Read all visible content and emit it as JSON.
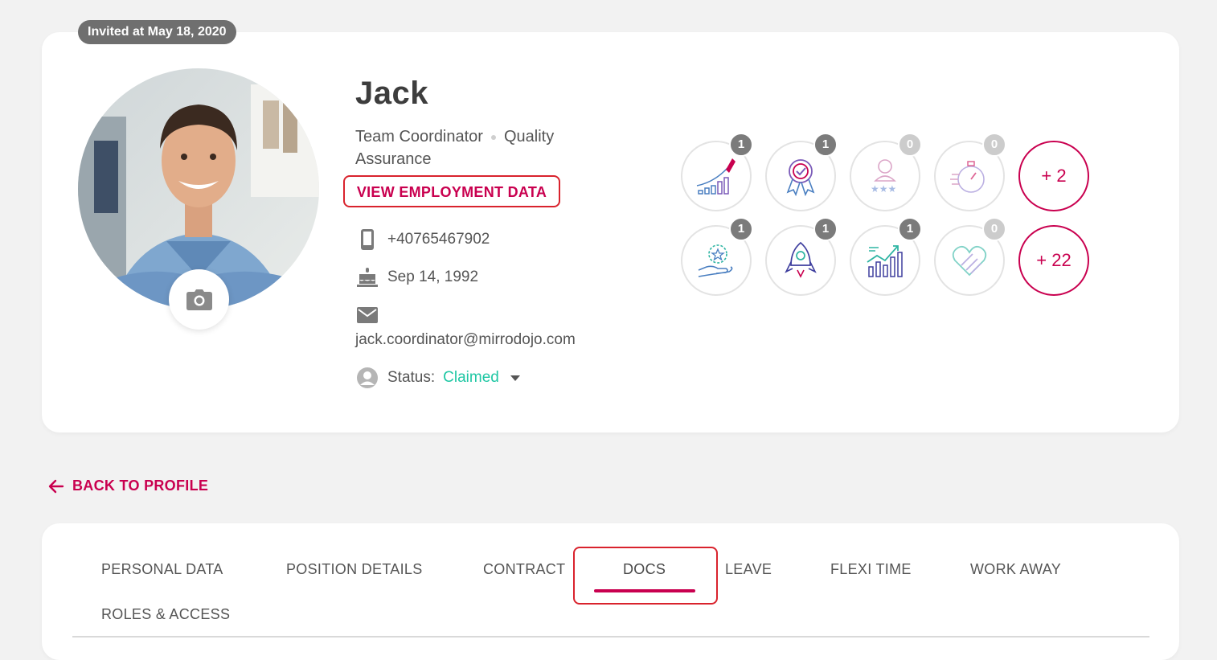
{
  "profile": {
    "invited_label": "Invited at May 18, 2020",
    "name": "Jack",
    "role": "Team Coordinator",
    "department": "Quality Assurance",
    "view_employment_label": "VIEW EMPLOYMENT DATA",
    "phone": "+40765467902",
    "birthday": "Sep 14, 1992",
    "email": "jack.coordinator@mirrodojo.com",
    "status_label": "Status:",
    "status_value": "Claimed"
  },
  "badges": {
    "row1": [
      {
        "icon": "rocket-growth-icon",
        "count": "1"
      },
      {
        "icon": "award-ribbon-icon",
        "count": "1"
      },
      {
        "icon": "person-rating-icon",
        "count": "0"
      },
      {
        "icon": "stopwatch-icon",
        "count": "0"
      }
    ],
    "row2": [
      {
        "icon": "hand-star-icon",
        "count": "1"
      },
      {
        "icon": "rocket-launch-icon",
        "count": "1"
      },
      {
        "icon": "growth-chart-icon",
        "count": "1"
      },
      {
        "icon": "heart-hand-icon",
        "count": "0"
      }
    ],
    "more_row1": "+ 2",
    "more_row2": "+ 22"
  },
  "nav": {
    "back_label": "BACK TO PROFILE"
  },
  "tabs": {
    "personal_data": "PERSONAL DATA",
    "position_details": "POSITION DETAILS",
    "contract": "CONTRACT",
    "docs": "DOCS",
    "leave": "LEAVE",
    "flexi_time": "FLEXI TIME",
    "work_away": "WORK AWAY",
    "roles_access": "ROLES & ACCESS",
    "active": "DOCS"
  },
  "colors": {
    "accent": "#c9004f",
    "highlight_border": "#d9232d",
    "status": "#1fc7a4",
    "background": "#f2f2f2"
  }
}
